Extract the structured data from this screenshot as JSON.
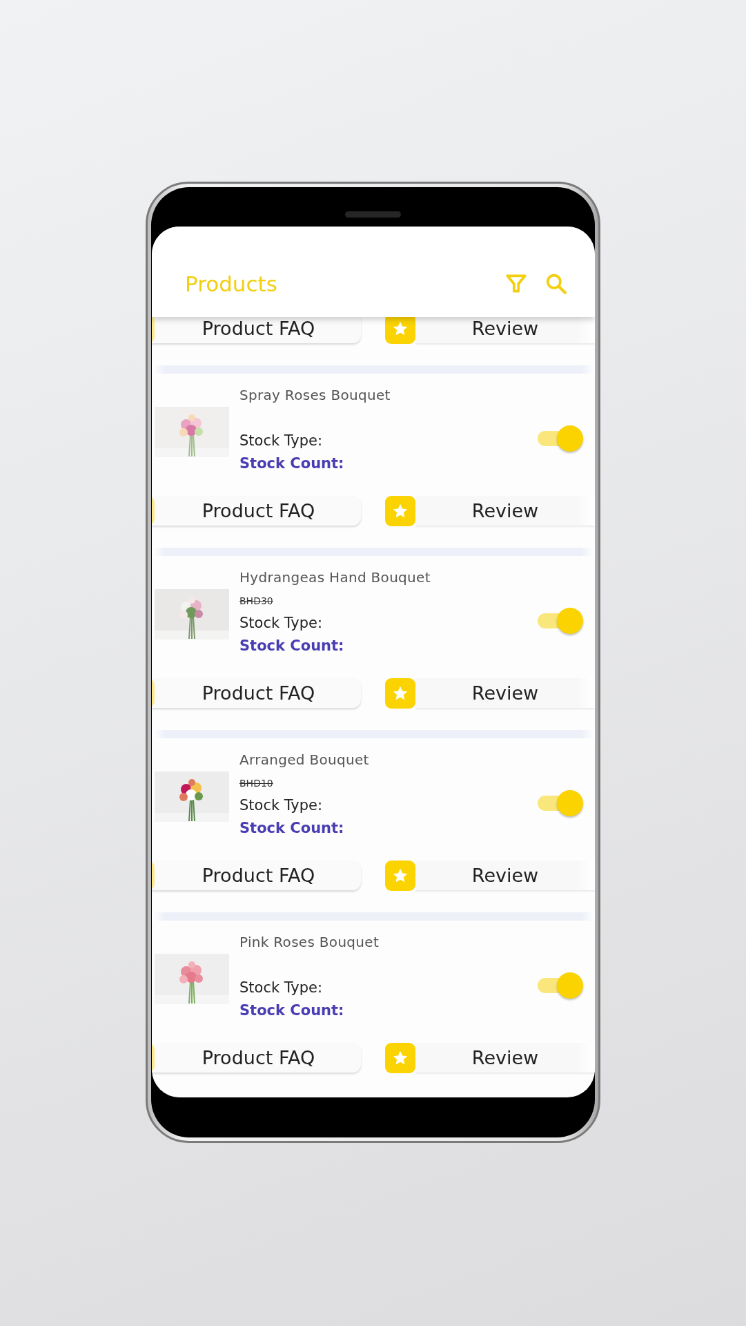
{
  "header": {
    "title": "Products"
  },
  "top_actions": {
    "faq_label": "Product FAQ",
    "review_label": "Review"
  },
  "products": [
    {
      "name": "Spray Roses Bouquet",
      "stock_type_label": "Stock Type:",
      "stock_count_label": "Stock Count:",
      "on": true,
      "faq_label": "Product FAQ",
      "review_label": "Review"
    },
    {
      "name": "Hydrangeas Hand Bouquet",
      "old_price": "BHD30",
      "stock_type_label": "Stock Type:",
      "stock_count_label": "Stock Count:",
      "on": true,
      "faq_label": "Product FAQ",
      "review_label": "Review"
    },
    {
      "name": "Arranged Bouquet",
      "old_price": "BHD10",
      "stock_type_label": "Stock Type:",
      "stock_count_label": "Stock Count:",
      "on": true,
      "faq_label": "Product FAQ",
      "review_label": "Review"
    },
    {
      "name": "Pink Roses Bouquet",
      "stock_type_label": "Stock Type:",
      "stock_count_label": "Stock Count:",
      "on": true,
      "faq_label": "Product FAQ",
      "review_label": "Review"
    }
  ]
}
